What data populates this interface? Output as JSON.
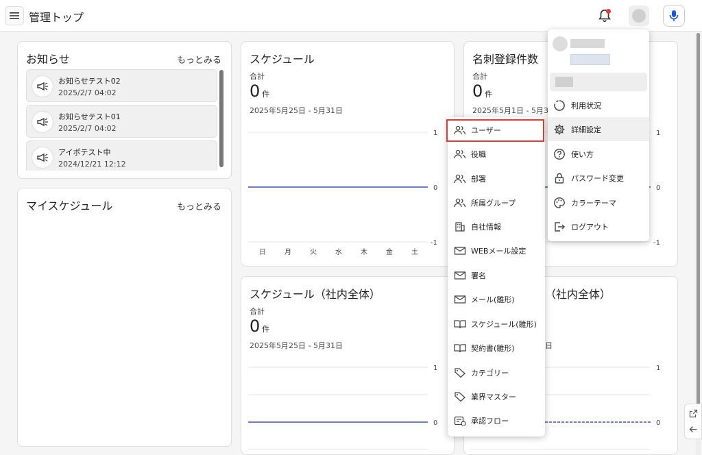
{
  "header": {
    "title": "管理トップ"
  },
  "notices": {
    "title": "お知らせ",
    "more": "もっとみる",
    "items": [
      {
        "title": "お知らせテスト02",
        "date": "2025/2/7 04:02"
      },
      {
        "title": "お知らせテスト01",
        "date": "2025/2/7 04:02"
      },
      {
        "title": "アイポテスト中",
        "date": "2024/12/21 12:12"
      }
    ]
  },
  "my_schedule": {
    "title": "マイスケジュール",
    "more": "もっとみる"
  },
  "schedule": {
    "title": "スケジュール",
    "sum_label": "合計",
    "value": "0",
    "unit": "件",
    "range": "2025年5月25日 - 5月31日",
    "days": [
      "日",
      "月",
      "火",
      "水",
      "木",
      "金",
      "土"
    ],
    "y_ticks": [
      "1",
      "0",
      "-1"
    ]
  },
  "cards_registered": {
    "title": "名刺登録件数",
    "sum_label": "合計",
    "value": "0",
    "unit": "件",
    "range": "2025年5月1日 - 5月31日",
    "y_ticks": [
      "1",
      "0",
      "-1"
    ]
  },
  "schedule_company": {
    "title": "スケジュール（社内全体）",
    "sum_label": "合計",
    "value": "0",
    "unit": "件",
    "range": "2025年5月25日 - 5月31日",
    "y_ticks": [
      "1",
      "0"
    ]
  },
  "card_company": {
    "title_partial": "（社内全体）",
    "range_partial": "日",
    "y_ticks": [
      "1",
      "0"
    ]
  },
  "settings_menu": {
    "items": [
      {
        "label": "ユーザー",
        "icon": "users-icon"
      },
      {
        "label": "役職",
        "icon": "users-icon"
      },
      {
        "label": "部署",
        "icon": "users-icon"
      },
      {
        "label": "所属グループ",
        "icon": "users-icon"
      },
      {
        "label": "自社情報",
        "icon": "building-icon"
      },
      {
        "label": "WEBメール設定",
        "icon": "mail-icon"
      },
      {
        "label": "署名",
        "icon": "mail-icon"
      },
      {
        "label": "メール(雛形)",
        "icon": "mail-icon"
      },
      {
        "label": "スケジュール(雛形)",
        "icon": "book-icon"
      },
      {
        "label": "契約書(雛形)",
        "icon": "book-icon"
      },
      {
        "label": "カテゴリー",
        "icon": "tag-icon"
      },
      {
        "label": "業界マスター",
        "icon": "tag-icon"
      },
      {
        "label": "承認フロー",
        "icon": "flow-icon"
      }
    ]
  },
  "user_menu": {
    "items": [
      {
        "label": "利用状況",
        "icon": "usage-icon"
      },
      {
        "label": "詳細設定",
        "icon": "gear-icon"
      },
      {
        "label": "使い方",
        "icon": "help-icon"
      },
      {
        "label": "パスワード変更",
        "icon": "lock-icon"
      },
      {
        "label": "カラーテーマ",
        "icon": "palette-icon"
      },
      {
        "label": "ログアウト",
        "icon": "logout-icon"
      }
    ]
  },
  "colors": {
    "accent": "#3f51b5",
    "highlight": "#e53935",
    "mic": "#1a56db"
  }
}
